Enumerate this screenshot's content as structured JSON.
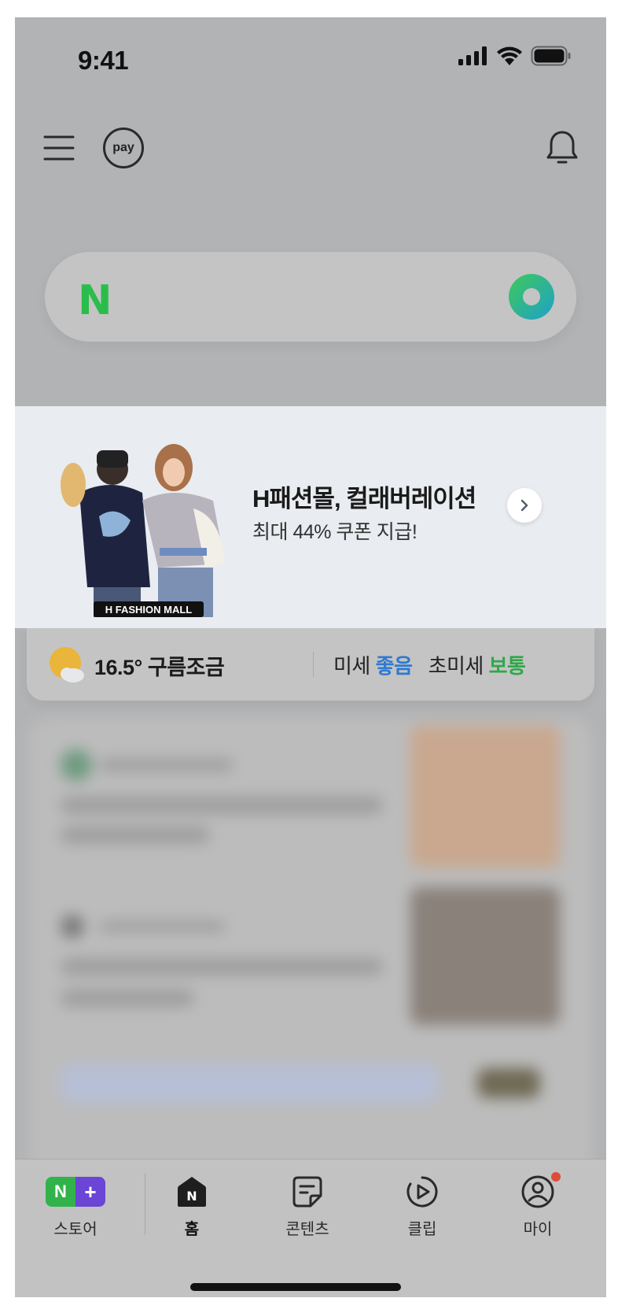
{
  "status_bar": {
    "time": "9:41"
  },
  "search": {
    "logo": "N"
  },
  "top_nav": {
    "pay_label": "pay"
  },
  "banner": {
    "brand_text": "H FASHION MALL",
    "title": "H패션몰, 컬래버레이션",
    "subtitle": "최대 44% 쿠폰 지급!"
  },
  "weather": {
    "temperature_condition": "16.5° 구름조금",
    "fine_dust_label": "미세",
    "fine_dust_value": "좋음",
    "ultrafine_dust_label": "초미세",
    "ultrafine_dust_value": "보통"
  },
  "tabbar": {
    "tabs": [
      {
        "label": "스토어",
        "icon": "store-badge-icon"
      },
      {
        "label": "홈",
        "icon": "home-icon"
      },
      {
        "label": "콘텐츠",
        "icon": "content-icon"
      },
      {
        "label": "클립",
        "icon": "clip-play-icon"
      },
      {
        "label": "마이",
        "icon": "profile-icon"
      }
    ]
  },
  "colors": {
    "naver_green": "#2bbd4b",
    "good_blue": "#2e7ad1",
    "normal_green": "#2fa84a",
    "store_purple": "#6a45d6",
    "notification_red": "#e14b3c"
  }
}
